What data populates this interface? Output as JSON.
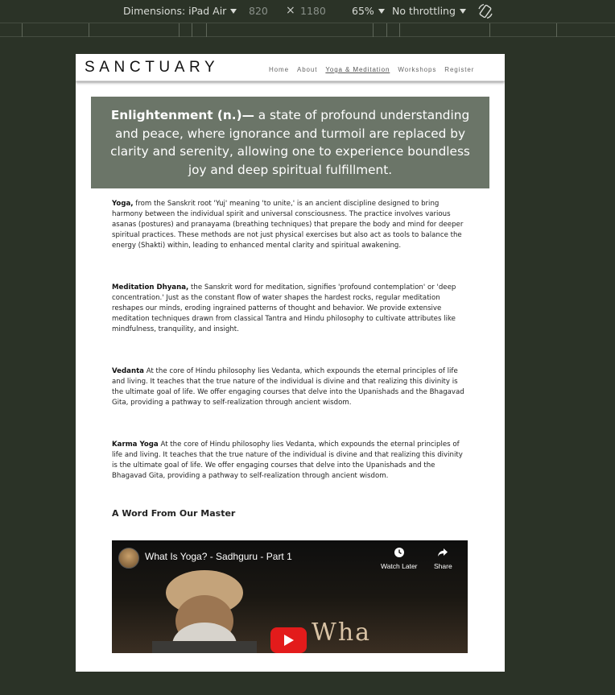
{
  "devtools": {
    "device_label": "Dimensions: iPad Air",
    "width": "820",
    "height": "1180",
    "times": "×",
    "zoom": "65%",
    "throttling": "No throttling",
    "rotate_icon": "rotate-icon"
  },
  "site": {
    "logo": "SANCTUARY",
    "nav": {
      "home": "Home",
      "about": "About",
      "yoga": "Yoga & Meditation",
      "workshops": "Workshops",
      "register": "Register"
    },
    "hero": {
      "term": "Enlightenment (n.)—",
      "definition": " a state of profound understanding and peace, where ignorance and turmoil are replaced by clarity and serenity, allowing one to experience boundless joy and deep spiritual fulfillment."
    },
    "sections": [
      {
        "title": "Yoga,",
        "text": " from the Sanskrit root 'Yuj' meaning 'to unite,' is an ancient discipline designed to bring harmony between the individual spirit and universal consciousness. The practice involves various asanas (postures) and pranayama (breathing techniques) that prepare the body and mind for deeper spiritual practices. These methods are not just physical exercises but also act as tools to balance the energy (Shakti) within, leading to enhanced mental clarity and spiritual awakening."
      },
      {
        "title": "Meditation Dhyana,",
        "text": " the Sanskrit word for meditation, signifies 'profound contemplation' or 'deep concentration.' Just as the constant flow of water shapes the hardest rocks, regular meditation reshapes our minds, eroding ingrained patterns of thought and behavior. We provide extensive meditation techniques drawn from classical Tantra and Hindu philosophy to cultivate attributes like mindfulness, tranquility, and insight."
      },
      {
        "title": "Vedanta",
        "text": " At the core of Hindu philosophy lies Vedanta, which expounds the eternal principles of life and living. It teaches that the true nature of the individual is divine and that realizing this divinity is the ultimate goal of life. We offer engaging courses that delve into the Upanishads and the Bhagavad Gita, providing a pathway to self-realization through ancient wisdom."
      },
      {
        "title": "Karma Yoga",
        "text": " At the core of Hindu philosophy lies Vedanta, which expounds the eternal principles of life and living. It teaches that the true nature of the individual is divine and that realizing this divinity is the ultimate goal of life. We offer engaging courses that delve into the Upanishads and the Bhagavad Gita, providing a pathway to self-realization through ancient wisdom."
      }
    ],
    "master_heading": "A Word From Our Master",
    "video": {
      "title": "What Is Yoga? - Sadhguru - Part 1",
      "watch_later": "Watch Later",
      "share": "Share",
      "overlay_text": "Wha"
    }
  }
}
